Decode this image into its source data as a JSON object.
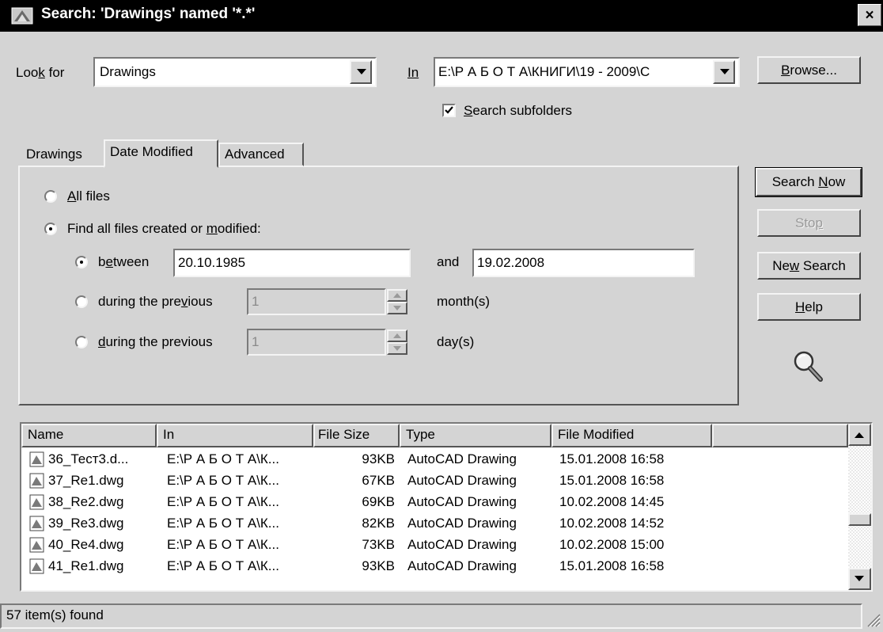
{
  "window": {
    "title": "Search: 'Drawings' named '*.*'",
    "close_label": "×"
  },
  "search_bar": {
    "look_for_label_pre": "Loo",
    "look_for_label_u": "k",
    "look_for_label_post": " for",
    "look_for_value": "Drawings",
    "in_label": "In",
    "in_value": "E:\\Р А Б О Т А\\КНИГИ\\19 - 2009\\C",
    "search_subfolders_u": "S",
    "search_subfolders_rest": "earch subfolders",
    "search_subfolders_checked": true,
    "browse_u": "B",
    "browse_rest": "rowse..."
  },
  "tabs": [
    {
      "label": "Drawings",
      "active": false
    },
    {
      "label": "Date Modified",
      "active": true
    },
    {
      "label": "Advanced",
      "active": false
    }
  ],
  "date_panel": {
    "all_files_u": "A",
    "all_files_rest": "ll files",
    "find_all_pre": "Find all files created or ",
    "find_all_u": "m",
    "find_all_post": "odified:",
    "between_pre": "b",
    "between_u": "e",
    "between_post": "tween",
    "between_from": "20.10.1985",
    "and_label": "and",
    "between_to": "19.02.2008",
    "prev_months_pre": "during the pre",
    "prev_months_u": "v",
    "prev_months_post": "ious",
    "prev_months_value": "1",
    "months_unit": "month(s)",
    "prev_days_u": "d",
    "prev_days_rest": "uring the previous",
    "prev_days_value": "1",
    "days_unit": "day(s)",
    "selected": "find_all",
    "sub_selected": "between"
  },
  "actions": {
    "search_now_pre": "Search ",
    "search_now_u": "N",
    "search_now_post": "ow",
    "stop_pre": "Sto",
    "stop_u": "p",
    "new_search_pre": "Ne",
    "new_search_u": "w",
    "new_search_post": " Search",
    "help_u": "H",
    "help_rest": "elp"
  },
  "results": {
    "columns": [
      "Name",
      "In",
      "File Size",
      "Type",
      "File Modified"
    ],
    "rows": [
      {
        "name": "36_Тест3.d...",
        "in": "E:\\Р А Б О Т А\\К...",
        "size": "93KB",
        "type": "AutoCAD Drawing",
        "modified": "15.01.2008 16:58"
      },
      {
        "name": "37_Re1.dwg",
        "in": "E:\\Р А Б О Т А\\К...",
        "size": "67KB",
        "type": "AutoCAD Drawing",
        "modified": "15.01.2008 16:58"
      },
      {
        "name": "38_Re2.dwg",
        "in": "E:\\Р А Б О Т А\\К...",
        "size": "69KB",
        "type": "AutoCAD Drawing",
        "modified": "10.02.2008 14:45"
      },
      {
        "name": "39_Re3.dwg",
        "in": "E:\\Р А Б О Т А\\К...",
        "size": "82KB",
        "type": "AutoCAD Drawing",
        "modified": "10.02.2008 14:52"
      },
      {
        "name": "40_Re4.dwg",
        "in": "E:\\Р А Б О Т А\\К...",
        "size": "73KB",
        "type": "AutoCAD Drawing",
        "modified": "10.02.2008 15:00"
      },
      {
        "name": "41_Re1.dwg",
        "in": "E:\\Р А Б О Т А\\К...",
        "size": "93KB",
        "type": "AutoCAD Drawing",
        "modified": "15.01.2008 16:58"
      }
    ]
  },
  "status_bar": {
    "text": "57 item(s) found"
  },
  "icons": {
    "title": "autocad-app-icon",
    "search_decoration": "magnifier-icon",
    "file": "dwg-file-icon"
  },
  "colors": {
    "title_bar": "#000000",
    "dialog_face": "#d4d4d4",
    "field_bg": "#ffffff"
  }
}
